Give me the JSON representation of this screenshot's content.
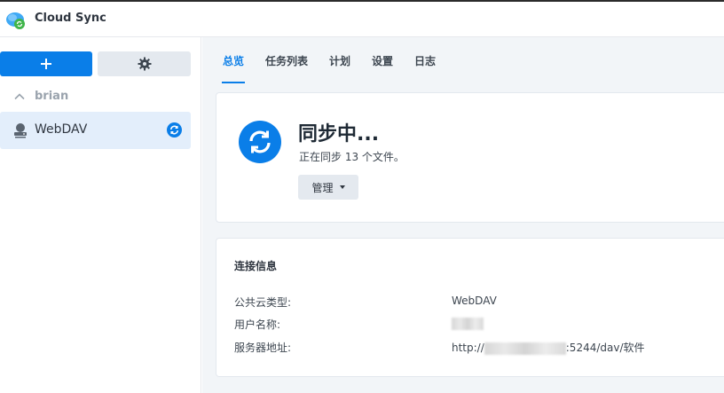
{
  "app": {
    "title": "Cloud Sync",
    "logo_icon": "cloud-sync-logo-icon"
  },
  "sidebar": {
    "add_icon": "plus-icon",
    "settings_icon": "gear-icon",
    "group": {
      "label": "brian",
      "icon": "chevron-up-icon"
    },
    "items": [
      {
        "label": "WebDAV",
        "icon": "server-icon",
        "status_icon": "sync-icon"
      }
    ]
  },
  "tabs": [
    {
      "label": "总览",
      "active": true
    },
    {
      "label": "任务列表",
      "active": false
    },
    {
      "label": "计划",
      "active": false
    },
    {
      "label": "设置",
      "active": false
    },
    {
      "label": "日志",
      "active": false
    }
  ],
  "status": {
    "icon": "sync-icon",
    "title": "同步中...",
    "subtitle": "正在同步 13 个文件。",
    "manage_label": "管理"
  },
  "connection": {
    "title": "连接信息",
    "rows": [
      {
        "key": "公共云类型:",
        "value": "WebDAV"
      },
      {
        "key": "用户名称:",
        "value": ""
      },
      {
        "key": "服务器地址:",
        "value_prefix": "http://",
        "value_suffix": ":5244/dav/软件"
      }
    ]
  },
  "colors": {
    "accent": "#0a7ee8",
    "selected_bg": "#e3eefb",
    "main_bg": "#f2f5f8"
  }
}
